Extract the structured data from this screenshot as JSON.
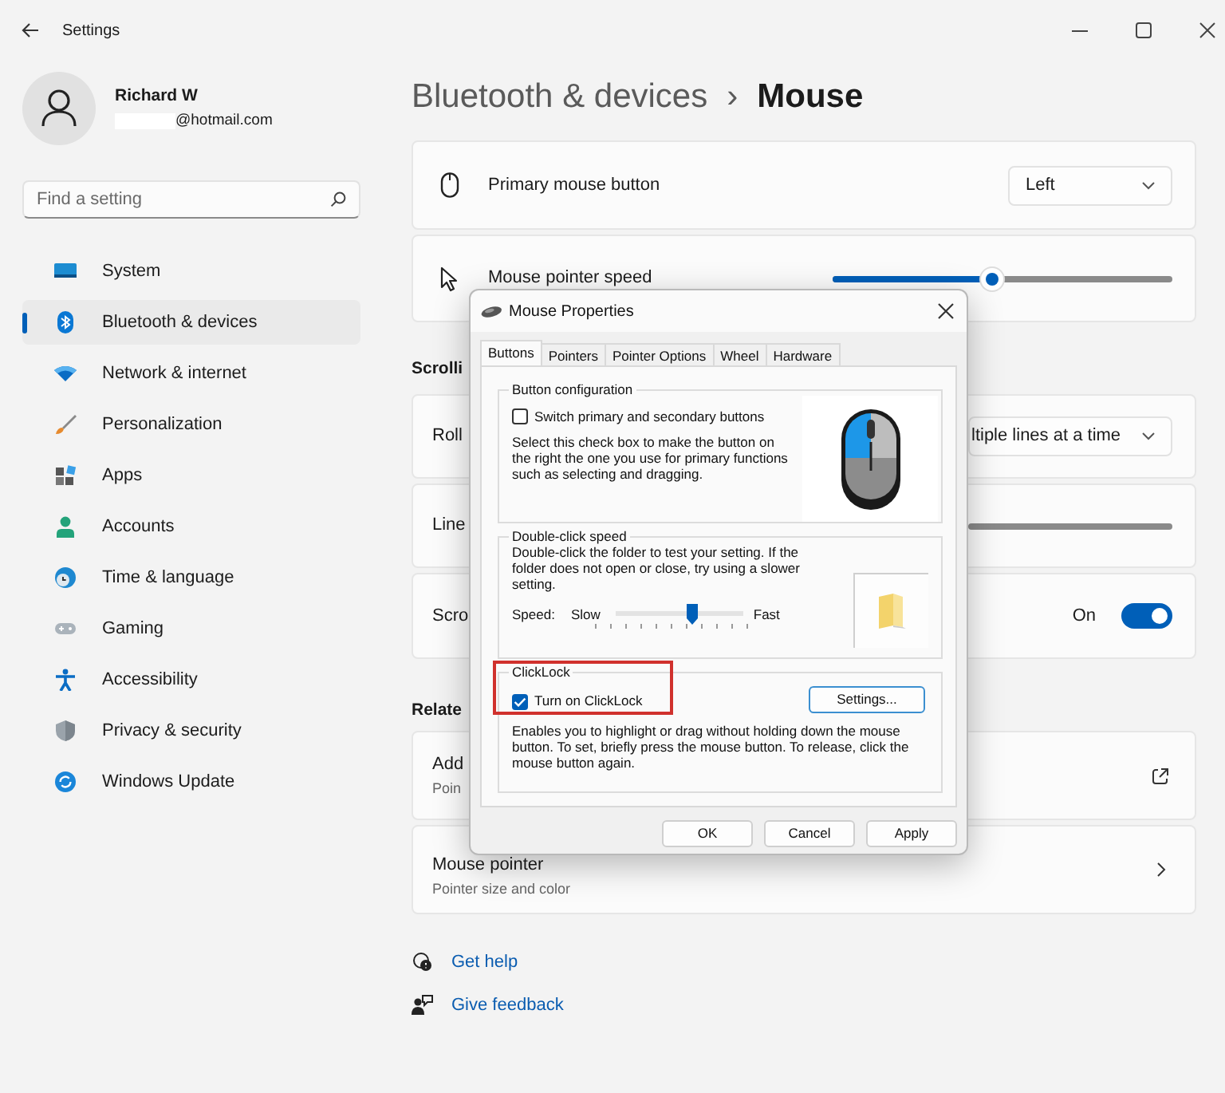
{
  "window": {
    "title": "Settings"
  },
  "user": {
    "name": "Richard W",
    "email": "@hotmail.com"
  },
  "search": {
    "placeholder": "Find a setting"
  },
  "sidebar": {
    "items": [
      {
        "label": "System",
        "selected": false
      },
      {
        "label": "Bluetooth & devices",
        "selected": true
      },
      {
        "label": "Network & internet",
        "selected": false
      },
      {
        "label": "Personalization",
        "selected": false
      },
      {
        "label": "Apps",
        "selected": false
      },
      {
        "label": "Accounts",
        "selected": false
      },
      {
        "label": "Time & language",
        "selected": false
      },
      {
        "label": "Gaming",
        "selected": false
      },
      {
        "label": "Accessibility",
        "selected": false
      },
      {
        "label": "Privacy & security",
        "selected": false
      },
      {
        "label": "Windows Update",
        "selected": false
      }
    ]
  },
  "breadcrumb": {
    "parent": "Bluetooth & devices",
    "separator": "›",
    "current": "Mouse"
  },
  "sections": [
    {
      "cards": [
        {
          "kind": "dropdown",
          "title": "Primary mouse button",
          "value": "Left"
        },
        {
          "kind": "slider",
          "title": "Mouse pointer speed",
          "level": 0.47
        }
      ]
    },
    {
      "heading": "Scrolli",
      "cards": [
        {
          "kind": "dropdown",
          "title": "Roll",
          "value": "ltiple lines at a time"
        },
        {
          "kind": "track",
          "title": "Line"
        },
        {
          "kind": "toggle",
          "title": "Scro",
          "state_label": "On",
          "on": true
        }
      ]
    },
    {
      "heading": "Relate",
      "cards": [
        {
          "kind": "external",
          "title": "Add",
          "subtitle": "Poin"
        },
        {
          "kind": "chevron",
          "title": "Mouse pointer",
          "subtitle": "Pointer size and color"
        }
      ]
    }
  ],
  "links": [
    "Get help",
    "Give feedback"
  ],
  "dialog": {
    "title": "Mouse Properties",
    "tabs": [
      {
        "label": "Buttons",
        "selected": true
      },
      {
        "label": "Pointers",
        "selected": false
      },
      {
        "label": "Pointer Options",
        "selected": false
      },
      {
        "label": "Wheel",
        "selected": false
      },
      {
        "label": "Hardware",
        "selected": false
      }
    ],
    "groups": [
      {
        "kind": "buttons",
        "legend": "Button configuration",
        "checkbox": {
          "label": "Switch primary and secondary buttons",
          "checked": false
        },
        "description": "Select this check box to make the button on the right the one you use for primary functions such as selecting and dragging."
      },
      {
        "kind": "speed",
        "legend": "Double-click speed",
        "description": "Double-click the folder to test your setting. If the folder does not open or close, try using a slower setting.",
        "speed_label": "Speed:",
        "slow": "Slow",
        "fast": "Fast",
        "level": 0.59
      },
      {
        "kind": "clicklock",
        "legend": "ClickLock",
        "highlighted": true,
        "checkbox": {
          "label": "Turn on ClickLock",
          "checked": true
        },
        "button": "Settings...",
        "description": "Enables you to highlight or drag without holding down the mouse button. To set, briefly press the mouse button. To release, click the mouse button again."
      }
    ],
    "buttons": [
      "OK",
      "Cancel",
      "Apply"
    ]
  }
}
